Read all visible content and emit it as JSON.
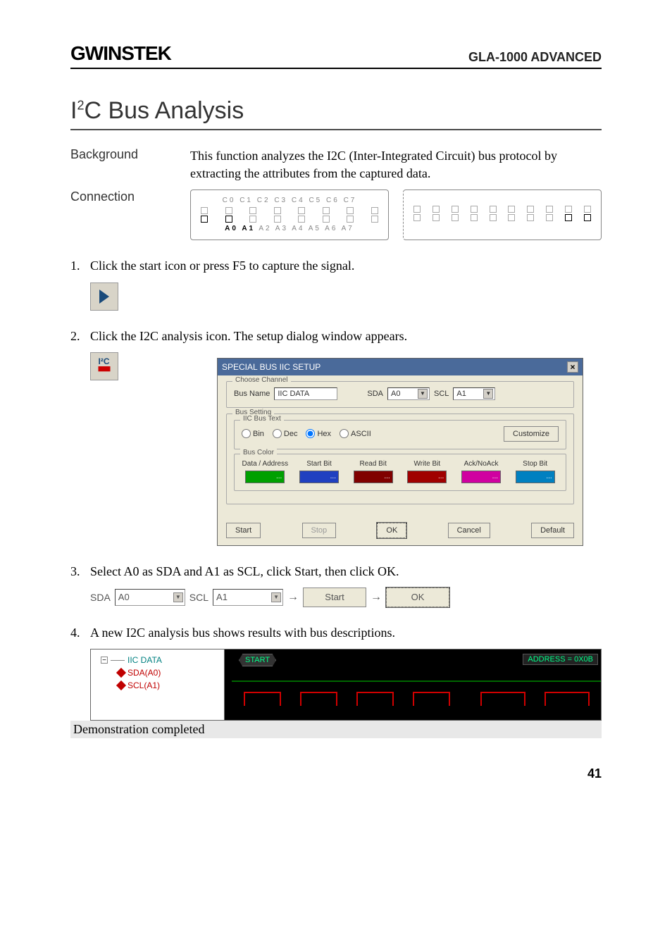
{
  "header": {
    "logo_text": "GWINSTEK",
    "right": "GLA-1000 ADVANCED"
  },
  "title_pre": "I",
  "title_sup": "2",
  "title_post": "C Bus Analysis",
  "rows": {
    "background_label": "Background",
    "background_text": "This function analyzes the I2C (Inter-Integrated Circuit) bus protocol by extracting the attributes from the captured data.",
    "connection_label": "Connection"
  },
  "diagram": {
    "top_labels": "C0 C1 C2 C3 C4 C5 C6 C7",
    "bottom_bold": "A0 A1",
    "bottom_rest": " A2 A3 A4 A5 A6 A7"
  },
  "steps": {
    "s1": "Click the start icon or press F5 to capture the signal.",
    "s2": "Click the I2C analysis icon. The setup dialog window appears.",
    "s3": "Select A0 as SDA and A1 as SCL, click Start, then click OK.",
    "s4": "A new I2C analysis bus shows results with bus descriptions."
  },
  "i2c_icon_top": "I²C",
  "dialog": {
    "title": "SPECIAL BUS IIC SETUP",
    "close": "×",
    "group_channel": "Choose Channel",
    "bus_name_label": "Bus Name",
    "bus_name_value": "IIC DATA",
    "sda_label": "SDA",
    "sda_value": "A0",
    "scl_label": "SCL",
    "scl_value": "A1",
    "group_bus_setting": "Bus Setting",
    "group_iic_text": "IIC Bus Text",
    "radio_bin": "Bin",
    "radio_dec": "Dec",
    "radio_hex": "Hex",
    "radio_ascii": "ASCII",
    "customize": "Customize",
    "group_bus_color": "Bus Color",
    "color_labels": [
      "Data / Address",
      "Start Bit",
      "Read Bit",
      "Write Bit",
      "Ack/NoAck",
      "Stop Bit"
    ],
    "swatch_dots": "...",
    "btn_start": "Start",
    "btn_stop": "Stop",
    "btn_ok": "OK",
    "btn_cancel": "Cancel",
    "btn_default": "Default"
  },
  "step3row": {
    "sda_label": "SDA",
    "sda_value": "A0",
    "scl_label": "SCL",
    "scl_value": "A1",
    "start": "Start",
    "ok": "OK"
  },
  "wave": {
    "bus_name": "IIC DATA",
    "sda": "SDA(A0)",
    "scl": "SCL(A1)",
    "start_tag": "START",
    "address_tag": "ADDRESS = 0X0B"
  },
  "demo_complete": "Demonstration completed",
  "page_number": "41"
}
